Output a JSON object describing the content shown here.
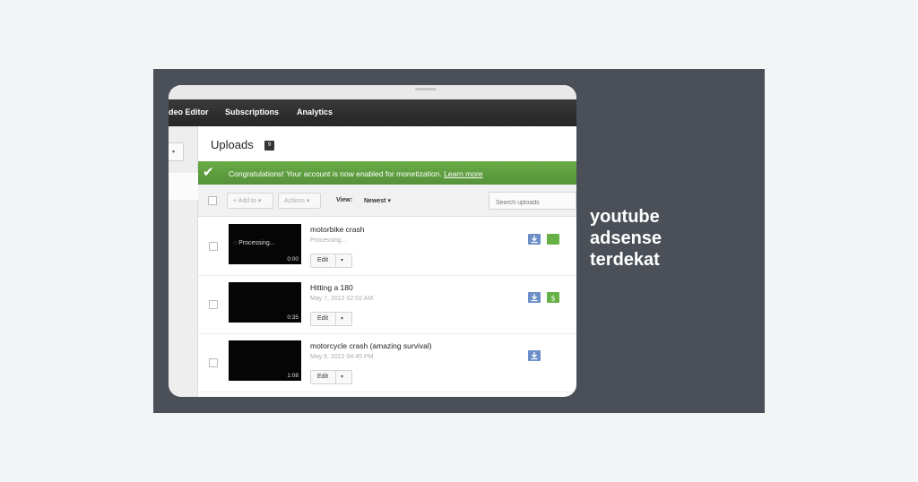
{
  "nav": {
    "items": [
      "deo Editor",
      "Subscriptions",
      "Analytics"
    ]
  },
  "page": {
    "title": "Uploads",
    "count": "9"
  },
  "banner": {
    "message": "Congratulations! Your account is now enabled for monetization.",
    "link": "Learn more"
  },
  "toolbar": {
    "add_to": "Add to",
    "actions": "Actions",
    "view_label": "View:",
    "view_value": "Newest",
    "search_placeholder": "Search uploads"
  },
  "videos": [
    {
      "title": "motorbike crash",
      "subtitle": "Processing...",
      "thumb_text": "Processing...",
      "duration": "0:00",
      "edit": "Edit"
    },
    {
      "title": "Hitting a 180",
      "subtitle": "May 7, 2012 02:02 AM",
      "thumb_text": "",
      "duration": "0:35",
      "edit": "Edit"
    },
    {
      "title": "motorcycle crash (amazing survival)",
      "subtitle": "May 6, 2012 04:45 PM",
      "thumb_text": "",
      "duration": "1:08",
      "edit": "Edit"
    }
  ],
  "caption": {
    "lines": [
      "youtube",
      "adsense",
      "terdekat"
    ]
  },
  "colors": {
    "panel": "#4b5058",
    "banner": "#5f9f40",
    "navbar": "#2e2e2e",
    "icon_blue": "#6b8ec7",
    "icon_green": "#67b045"
  }
}
